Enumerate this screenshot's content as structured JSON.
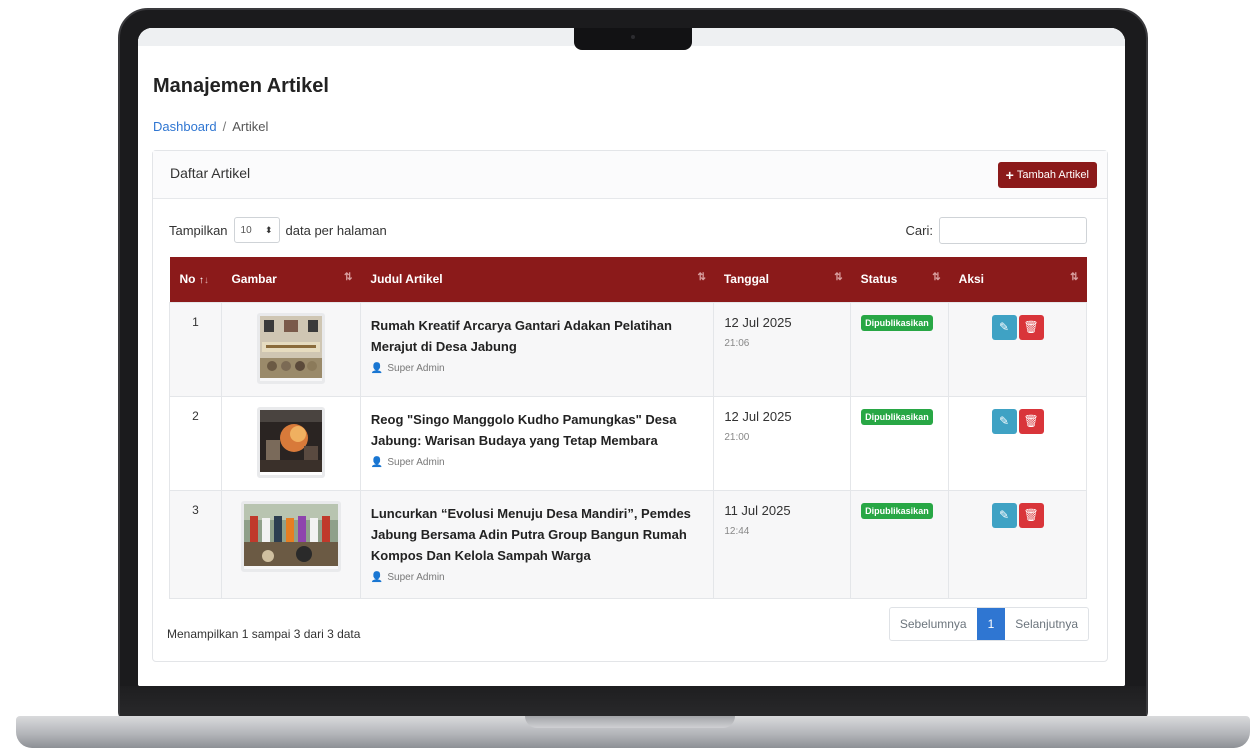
{
  "page": {
    "title": "Manajemen Artikel",
    "breadcrumb": {
      "home": "Dashboard",
      "separator": "/",
      "current": "Artikel"
    }
  },
  "card": {
    "title": "Daftar Artikel",
    "add_button": "Tambah Artikel"
  },
  "controls": {
    "show_prefix": "Tampilkan",
    "page_size": "10",
    "show_suffix": "data per halaman",
    "search_label": "Cari:",
    "search_value": ""
  },
  "table": {
    "headers": [
      "No",
      "Gambar",
      "Judul Artikel",
      "Tanggal",
      "Status",
      "Aksi"
    ],
    "rows": [
      {
        "no": "1",
        "title": "Rumah Kreatif Arcarya Gantari Adakan Pelatihan Merajut di Desa Jabung",
        "author": "Super Admin",
        "date": "12 Jul 2025",
        "time": "21:06",
        "status": "Dipublikasikan"
      },
      {
        "no": "2",
        "title": "Reog \"Singo Manggolo Kudho Pamungkas\" Desa Jabung: Warisan Budaya yang Tetap Membara",
        "author": "Super Admin",
        "date": "12 Jul 2025",
        "time": "21:00",
        "status": "Dipublikasikan"
      },
      {
        "no": "3",
        "title": "Luncurkan “Evolusi Menuju Desa Mandiri”, Pemdes Jabung Bersama Adin Putra Group Bangun Rumah Kompos Dan Kelola Sampah Warga",
        "author": "Super Admin",
        "date": "11 Jul 2025",
        "time": "12:44",
        "status": "Dipublikasikan"
      }
    ]
  },
  "footer": {
    "info": "Menampilkan 1 sampai 3 dari 3 data",
    "prev": "Sebelumnya",
    "current_page": "1",
    "next": "Selanjutnya"
  },
  "colors": {
    "brand": "#8b1a1a",
    "link": "#2f76d2",
    "published": "#28a745",
    "edit": "#3fa2c4",
    "delete": "#d9353a"
  }
}
